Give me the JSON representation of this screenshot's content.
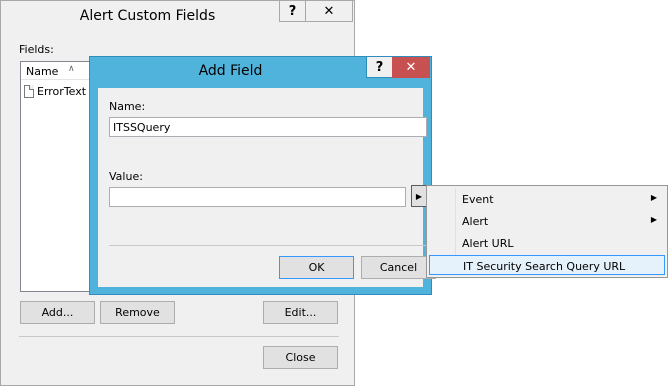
{
  "bg_dialog": {
    "title": "Alert Custom Fields",
    "help": "?",
    "close": "✕",
    "fields_label": "Fields:",
    "column_name": "Name",
    "sort_glyph": "∧",
    "items": [
      "ErrorText"
    ],
    "buttons": {
      "add": "Add...",
      "remove": "Remove",
      "edit": "Edit...",
      "close": "Close"
    }
  },
  "fg_dialog": {
    "title": "Add Field",
    "help": "?",
    "close": "✕",
    "name_label": "Name:",
    "name_value": "ITSSQuery",
    "value_label": "Value:",
    "value_value": "",
    "insert_glyph": "▶",
    "buttons": {
      "ok": "OK",
      "cancel": "Cancel"
    }
  },
  "menu": {
    "items": [
      {
        "label": "Event",
        "submenu": "▶"
      },
      {
        "label": "Alert",
        "submenu": "▶"
      },
      {
        "label": "Alert URL"
      },
      {
        "label": "IT Security Search Query URL"
      }
    ]
  },
  "colors": {
    "titlebar_active": "#4fb3dc",
    "close_active": "#c75050",
    "highlight": "#e5f1fb"
  },
  "icons": {
    "list_item": "document-icon",
    "insert": "play-arrow-icon",
    "submenu": "chevron-right-icon"
  }
}
